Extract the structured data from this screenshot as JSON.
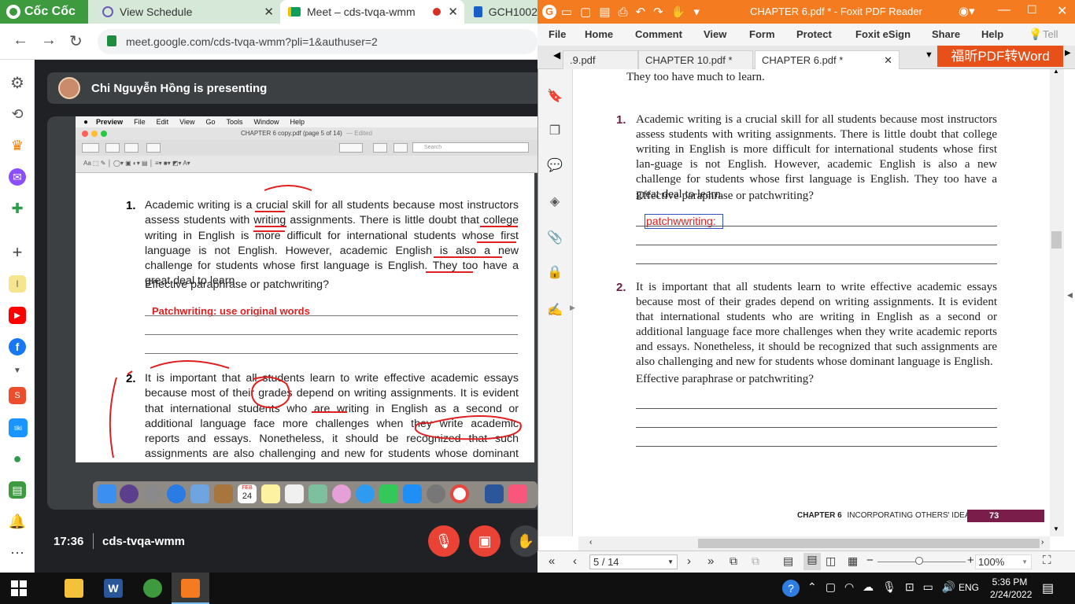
{
  "browser": {
    "tabs": [
      {
        "label": "Cốc Cốc",
        "icon": "coccoc-logo"
      },
      {
        "label": "View Schedule",
        "icon": "schedule-icon"
      },
      {
        "label": "Meet – cds-tvqa-wmm",
        "icon": "meet-icon"
      },
      {
        "label": "GCH1002",
        "icon": "doc-icon"
      }
    ],
    "url": "meet.google.com/cds-tvqa-wmm?pli=1&authuser=2"
  },
  "meet": {
    "presenter_text": "Chi Nguyễn Hồng is presenting",
    "time": "17:36",
    "meeting_code": "cds-tvqa-wmm"
  },
  "mac": {
    "menu": [
      "Preview",
      "File",
      "Edit",
      "View",
      "Go",
      "Tools",
      "Window",
      "Help"
    ],
    "window_title": "CHAPTER 6 copy.pdf (page 5 of 14)",
    "edited": "— Edited",
    "search_placeholder": "Search",
    "dock_date_month": "FEB",
    "dock_date_day": "24"
  },
  "shared_doc": {
    "item1_num": "1.",
    "item1_text": "Academic writing is a crucial skill for all students because most instructors assess students with writing assignments. There is little doubt that college writing in English is more difficult for international students whose first language is not English. However, academic English is also a new challenge for students whose first language is English. They too have a great deal to learn.",
    "question": "Effective paraphrase or patchwriting?",
    "annotation": "Patchwriting: use original words",
    "item2_num": "2.",
    "item2_text": "It is important that all students learn to write effective academic essays because most of their grades depend on writing assignments. It is evident that international students who are writing in English as a second or additional language face more challenges when they write academic reports and essays. Nonetheless, it should be recognized that such assignments are also challenging and new for students whose dominant language is English."
  },
  "foxit": {
    "title": "CHAPTER 6.pdf * - Foxit PDF Reader",
    "menu": [
      "File",
      "Home",
      "Comment",
      "View",
      "Form",
      "Protect",
      "Foxit eSign",
      "Share",
      "Help",
      "Tell"
    ],
    "tabs": [
      ".9.pdf",
      "CHAPTER 10.pdf *",
      "CHAPTER 6.pdf *"
    ],
    "promo": "福昕PDF转Word",
    "top_text": "They too have much to learn.",
    "item1_num": "1.",
    "item1_text": "Academic writing is a crucial skill for all students because most instructors assess students with writing assignments. There is little doubt that college writing in English is more difficult for international students whose first lan-guage is not English. However, academic English is also a new challenge for students whose first language is English. They too have a great deal to learn.",
    "question1": "Effective paraphrase or patchwriting?",
    "input_text": "patchwwriting:",
    "item2_num": "2.",
    "item2_text": "It is important that all students learn to write effective academic essays because most of their grades depend on writing assignments. It is evident that international students who are writing in English as a second or additional language face more challenges when they write academic reports and essays. Nonetheless, it should be recognized that such assignments are also challenging and new for students whose dominant language is English.",
    "question2": "Effective paraphrase or patchwriting?",
    "footer_chapter": "CHAPTER 6",
    "footer_title": "INCORPORATING OTHERS' IDEAS",
    "footer_page": "73",
    "page_field": "5 / 14",
    "zoom": "100%"
  },
  "taskbar": {
    "lang": "ENG",
    "time": "5:36 PM",
    "date": "2/24/2022"
  },
  "colors": {
    "coccoc_green": "#d6e8d8",
    "foxit_orange": "#f47b20",
    "meet_red": "#ea4335",
    "annotation_red": "#e02020"
  }
}
